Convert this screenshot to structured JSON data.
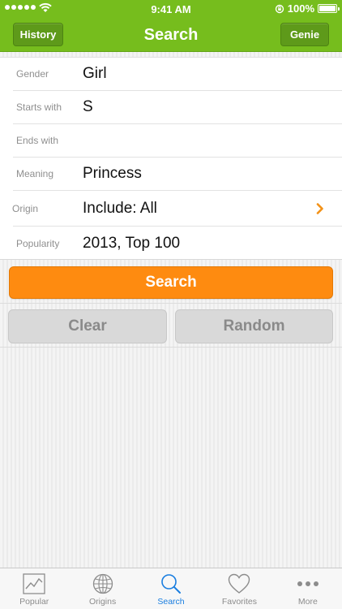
{
  "status_bar": {
    "time": "9:41 AM",
    "battery": "100%"
  },
  "nav": {
    "left_button": "History",
    "title": "Search",
    "right_button": "Genie"
  },
  "form": {
    "rows": [
      {
        "label": "Gender",
        "value": "Girl"
      },
      {
        "label": "Starts with",
        "value": "S"
      },
      {
        "label": "Ends with",
        "value": ""
      },
      {
        "label": "Meaning",
        "value": "Princess"
      },
      {
        "label": "Origin",
        "value": "Include: All"
      },
      {
        "label": "Popularity",
        "value": "2013, Top 100"
      }
    ]
  },
  "actions": {
    "search": "Search",
    "clear": "Clear",
    "random": "Random"
  },
  "tabs": [
    {
      "label": "Popular",
      "icon": "chart-icon"
    },
    {
      "label": "Origins",
      "icon": "globe-icon"
    },
    {
      "label": "Search",
      "icon": "search-icon"
    },
    {
      "label": "Favorites",
      "icon": "heart-icon"
    },
    {
      "label": "More",
      "icon": "more-icon"
    }
  ],
  "colors": {
    "header_green": "#76bd1d",
    "search_orange": "#fe8b10",
    "tab_active_blue": "#1a7ee0",
    "chevron_orange": "#f39116"
  }
}
